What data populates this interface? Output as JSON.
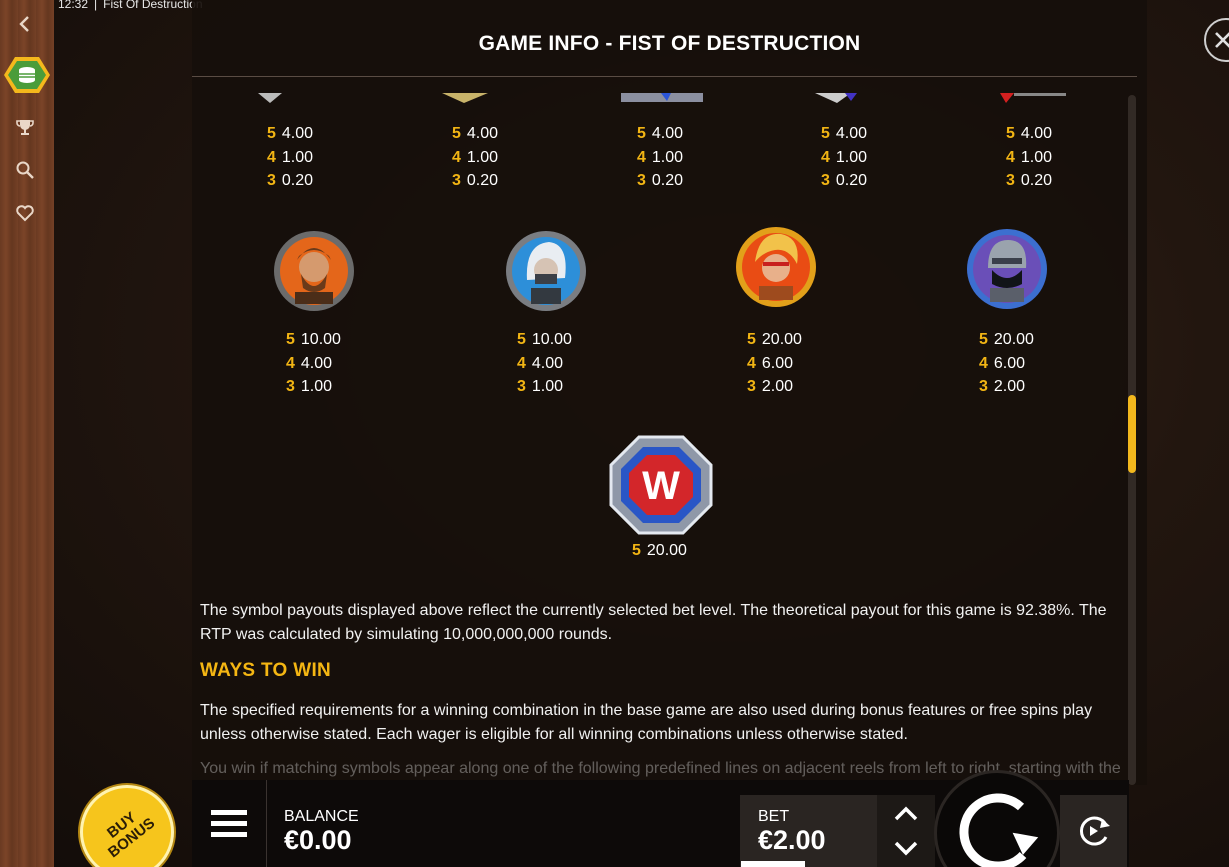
{
  "status_bar": {
    "time": "12:32",
    "app_title": "Fist Of Destruction"
  },
  "panel": {
    "title": "GAME INFO - FIST OF DESTRUCTION"
  },
  "paytable": {
    "low_symbols": [
      {
        "pays": [
          {
            "count": "5",
            "value": "4.00"
          },
          {
            "count": "4",
            "value": "1.00"
          },
          {
            "count": "3",
            "value": "0.20"
          }
        ]
      },
      {
        "pays": [
          {
            "count": "5",
            "value": "4.00"
          },
          {
            "count": "4",
            "value": "1.00"
          },
          {
            "count": "3",
            "value": "0.20"
          }
        ]
      },
      {
        "pays": [
          {
            "count": "5",
            "value": "4.00"
          },
          {
            "count": "4",
            "value": "1.00"
          },
          {
            "count": "3",
            "value": "0.20"
          }
        ]
      },
      {
        "pays": [
          {
            "count": "5",
            "value": "4.00"
          },
          {
            "count": "4",
            "value": "1.00"
          },
          {
            "count": "3",
            "value": "0.20"
          }
        ]
      },
      {
        "pays": [
          {
            "count": "5",
            "value": "4.00"
          },
          {
            "count": "4",
            "value": "1.00"
          },
          {
            "count": "3",
            "value": "0.20"
          }
        ]
      }
    ],
    "high_symbols": [
      {
        "icon": "bearded-fighter-icon",
        "pays": [
          {
            "count": "5",
            "value": "10.00"
          },
          {
            "count": "4",
            "value": "4.00"
          },
          {
            "count": "3",
            "value": "1.00"
          }
        ]
      },
      {
        "icon": "white-haired-ninja-icon",
        "pays": [
          {
            "count": "5",
            "value": "10.00"
          },
          {
            "count": "4",
            "value": "4.00"
          },
          {
            "count": "3",
            "value": "1.00"
          }
        ]
      },
      {
        "icon": "blonde-fighter-icon",
        "pays": [
          {
            "count": "5",
            "value": "20.00"
          },
          {
            "count": "4",
            "value": "6.00"
          },
          {
            "count": "3",
            "value": "2.00"
          }
        ]
      },
      {
        "icon": "masked-ninja-icon",
        "pays": [
          {
            "count": "5",
            "value": "20.00"
          },
          {
            "count": "4",
            "value": "6.00"
          },
          {
            "count": "3",
            "value": "2.00"
          }
        ]
      }
    ],
    "wild_symbol": {
      "icon": "wild-w-icon",
      "letter": "W",
      "pays": [
        {
          "count": "5",
          "value": "20.00"
        }
      ]
    }
  },
  "rtp_text": "The symbol payouts displayed above reflect the currently selected bet level. The theoretical payout for this game is 92.38%. The RTP was calculated by simulating 10,000,000,000 rounds.",
  "ways_heading": "WAYS TO WIN",
  "ways_text": "The specified requirements for a winning combination in the base game are also used during bonus features or free spins play unless otherwise stated. Each wager is eligible for all winning combinations unless otherwise stated.",
  "faded_text": "You win if matching symbols appear along one of the following predefined lines on adjacent reels from left to right, starting with the",
  "bottom_bar": {
    "balance_label": "BALANCE",
    "balance_value": "€0.00",
    "bet_label": "BET",
    "bet_value": "€2.00",
    "buy_bonus_label": "BUY BONUS"
  },
  "colors": {
    "accent": "#f2b514",
    "panel": "#160f0b",
    "rail": "#6a3a22"
  }
}
